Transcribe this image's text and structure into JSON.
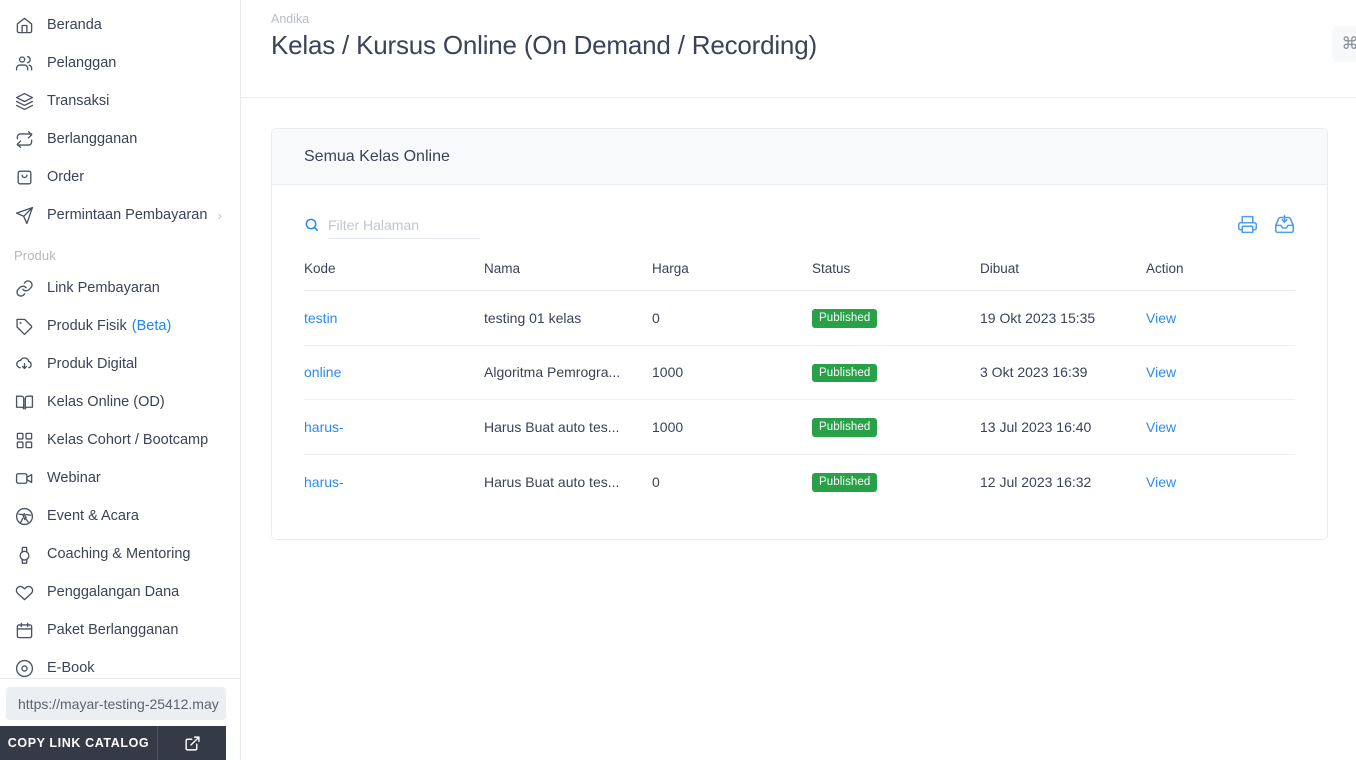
{
  "sidebar": {
    "primary_items": [
      {
        "label": "Beranda",
        "icon": "home-icon"
      },
      {
        "label": "Pelanggan",
        "icon": "users-icon"
      },
      {
        "label": "Transaksi",
        "icon": "layers-icon"
      },
      {
        "label": "Berlangganan",
        "icon": "refresh-icon"
      },
      {
        "label": "Order",
        "icon": "bag-icon"
      },
      {
        "label": "Permintaan Pembayaran",
        "icon": "send-icon",
        "chevron": "›"
      }
    ],
    "section_label": "Produk",
    "product_items": [
      {
        "label": "Link Pembayaran",
        "icon": "link-icon"
      },
      {
        "label": "Produk Fisik",
        "badge": "(Beta)",
        "icon": "tag-icon"
      },
      {
        "label": "Produk Digital",
        "icon": "cloud-download-icon"
      },
      {
        "label": "Kelas Online (OD)",
        "icon": "book-open-icon"
      },
      {
        "label": "Kelas Cohort / Bootcamp",
        "icon": "grid-icon"
      },
      {
        "label": "Webinar",
        "icon": "video-icon"
      },
      {
        "label": "Event & Acara",
        "icon": "aperture-icon"
      },
      {
        "label": "Coaching & Mentoring",
        "icon": "watch-icon"
      },
      {
        "label": "Penggalangan Dana",
        "icon": "heart-icon"
      },
      {
        "label": "Paket Berlangganan",
        "icon": "calendar-icon"
      },
      {
        "label": "E-Book",
        "icon": "disc-icon"
      }
    ],
    "catalog_url": "https://mayar-testing-25412.may",
    "copy_link_label": "COPY LINK CATALOG",
    "external_icon": "external-link-icon"
  },
  "header": {
    "breadcrumb": "Andika",
    "title": "Kelas / Kursus Online (On Demand / Recording)",
    "command_key": "⌘"
  },
  "card": {
    "title": "Semua Kelas Online",
    "search": {
      "placeholder": "Filter Halaman",
      "value": "",
      "icon": "search-icon"
    },
    "actions": [
      {
        "name": "print-icon"
      },
      {
        "name": "download-icon"
      }
    ],
    "columns": [
      "Kode",
      "Nama",
      "Harga",
      "Status",
      "Dibuat",
      "Action"
    ],
    "rows": [
      {
        "kode": "testin",
        "nama": "testing 01 kelas",
        "harga": "0",
        "status": "Published",
        "dibuat": "19 Okt 2023 15:35",
        "action": "View"
      },
      {
        "kode": "online",
        "nama": "Algoritma Pemrogra...",
        "harga": "1000",
        "status": "Published",
        "dibuat": "3 Okt 2023 16:39",
        "action": "View"
      },
      {
        "kode": "harus-",
        "nama": "Harus Buat auto tes...",
        "harga": "1000",
        "status": "Published",
        "dibuat": "13 Jul 2023 16:40",
        "action": "View"
      },
      {
        "kode": "harus-",
        "nama": "Harus Buat auto tes...",
        "harga": "0",
        "status": "Published",
        "dibuat": "12 Jul 2023 16:32",
        "action": "View"
      }
    ]
  },
  "colors": {
    "link": "#2a8bf2",
    "badge_published": "#28a148",
    "sidebar_border": "#e8eaed",
    "card_header_bg": "#f8f9fb",
    "dark_bar": "#343a46"
  }
}
